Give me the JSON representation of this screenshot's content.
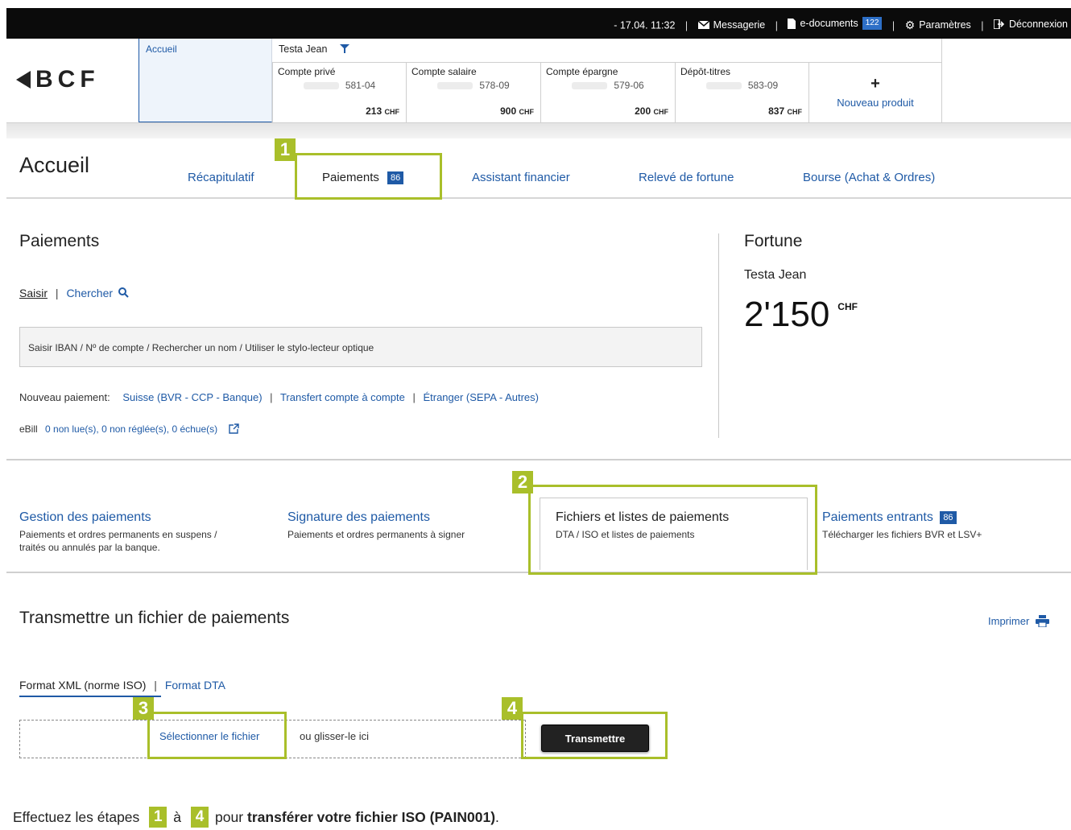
{
  "topbar": {
    "datetime": "- 17.04. 11:32",
    "messagerie": "Messagerie",
    "edocuments": "e-documents",
    "edocuments_count": "122",
    "parametres": "Paramètres",
    "deconnexion": "Déconnexion"
  },
  "header": {
    "logo": "BCF",
    "home_tab": "Accueil",
    "owner": "Testa Jean",
    "accounts": [
      {
        "name": "Compte privé",
        "number": "581-04",
        "amount": "213",
        "currency": "CHF"
      },
      {
        "name": "Compte salaire",
        "number": "578-09",
        "amount": "900",
        "currency": "CHF"
      },
      {
        "name": "Compte épargne",
        "number": "579-06",
        "amount": "200",
        "currency": "CHF"
      },
      {
        "name": "Dépôt-titres",
        "number": "583-09",
        "amount": "837",
        "currency": "CHF"
      }
    ],
    "new_product_plus": "+",
    "new_product": "Nouveau produit"
  },
  "nav": {
    "page_title": "Accueil",
    "tabs": [
      {
        "label": "Récapitulatif"
      },
      {
        "label": "Paiements",
        "badge": "86"
      },
      {
        "label": "Assistant financier"
      },
      {
        "label": "Relevé de fortune"
      },
      {
        "label": "Bourse (Achat & Ordres)"
      }
    ]
  },
  "payments": {
    "title": "Paiements",
    "saisir": "Saisir",
    "chercher": "Chercher",
    "search_placeholder": "Saisir IBAN / Nº de compte / Rechercher un nom / Utiliser le stylo-lecteur optique",
    "new_payment_label": "Nouveau paiement:",
    "new_payment_links": [
      "Suisse (BVR - CCP - Banque)",
      "Transfert compte à compte",
      "Étranger (SEPA - Autres)"
    ],
    "ebill_label": "eBill",
    "ebill_status": "0 non lue(s), 0 non réglée(s), 0 échue(s)"
  },
  "fortune": {
    "title": "Fortune",
    "owner": "Testa Jean",
    "amount": "2'150",
    "currency": "CHF"
  },
  "cards": [
    {
      "title": "Gestion des paiements",
      "desc1": "Paiements et ordres permanents en suspens /",
      "desc2": "traités ou annulés par la banque."
    },
    {
      "title": "Signature des paiements",
      "desc1": "Paiements et ordres permanents à signer",
      "desc2": ""
    },
    {
      "title": "Fichiers et listes de paiements",
      "desc1": "DTA / ISO et listes de paiements",
      "desc2": ""
    },
    {
      "title": "Paiements entrants",
      "badge": "86",
      "desc1": "Télécharger les fichiers BVR et LSV+",
      "desc2": ""
    }
  ],
  "transmit": {
    "title": "Transmettre un fichier de paiements",
    "print": "Imprimer",
    "format_xml": "Format XML (norme ISO)",
    "format_dta": "Format DTA",
    "select_file": "Sélectionner le fichier",
    "drop_text": "ou glisser-le ici",
    "submit": "Transmettre"
  },
  "steps": [
    "1",
    "2",
    "3",
    "4"
  ],
  "instruction": {
    "prefix": "Effectuez les étapes",
    "from": "1",
    "middle": "à",
    "to": "4",
    "mid2": "pour",
    "bold": "transférer votre fichier ISO (PAIN001)",
    "suffix": "."
  },
  "colors": {
    "accent": "#1f5aa6",
    "highlight": "#a9bf2a",
    "topbar": "#0b0b0b"
  }
}
